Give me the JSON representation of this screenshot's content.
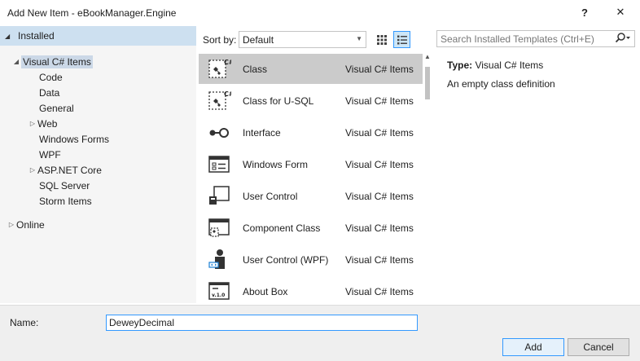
{
  "window": {
    "title": "Add New Item - eBookManager.Engine",
    "help_label": "?",
    "close_label": "✕"
  },
  "sidebar": {
    "installed_label": "Installed",
    "items": [
      {
        "label": "Visual C# Items",
        "arrow": "◢",
        "selected": true
      },
      {
        "label": "Code",
        "arrow": ""
      },
      {
        "label": "Data",
        "arrow": ""
      },
      {
        "label": "General",
        "arrow": ""
      },
      {
        "label": "Web",
        "arrow": "▷"
      },
      {
        "label": "Windows Forms",
        "arrow": ""
      },
      {
        "label": "WPF",
        "arrow": ""
      },
      {
        "label": "ASP.NET Core",
        "arrow": "▷"
      },
      {
        "label": "SQL Server",
        "arrow": ""
      },
      {
        "label": "Storm Items",
        "arrow": ""
      }
    ],
    "online_label": "Online"
  },
  "toolbar": {
    "sort_label": "Sort by:",
    "sort_value": "Default"
  },
  "search": {
    "placeholder": "Search Installed Templates (Ctrl+E)"
  },
  "templates": [
    {
      "name": "Class",
      "category": "Visual C# Items",
      "icon": "class-icon",
      "selected": true
    },
    {
      "name": "Class for U-SQL",
      "category": "Visual C# Items",
      "icon": "class-usql-icon"
    },
    {
      "name": "Interface",
      "category": "Visual C# Items",
      "icon": "interface-icon"
    },
    {
      "name": "Windows Form",
      "category": "Visual C# Items",
      "icon": "windows-form-icon"
    },
    {
      "name": "User Control",
      "category": "Visual C# Items",
      "icon": "user-control-icon"
    },
    {
      "name": "Component Class",
      "category": "Visual C# Items",
      "icon": "component-class-icon"
    },
    {
      "name": "User Control (WPF)",
      "category": "Visual C# Items",
      "icon": "user-control-wpf-icon"
    },
    {
      "name": "About Box",
      "category": "Visual C# Items",
      "icon": "about-box-icon"
    }
  ],
  "details": {
    "type_label": "Type:",
    "type_value": "Visual C# Items",
    "description": "An empty class definition"
  },
  "footer": {
    "name_label": "Name:",
    "name_value": "DeweyDecimal",
    "add_label": "Add",
    "cancel_label": "Cancel"
  },
  "colors": {
    "selection": "#cde0f0",
    "list_selection": "#cbcbcb",
    "accent": "#3399ff"
  }
}
